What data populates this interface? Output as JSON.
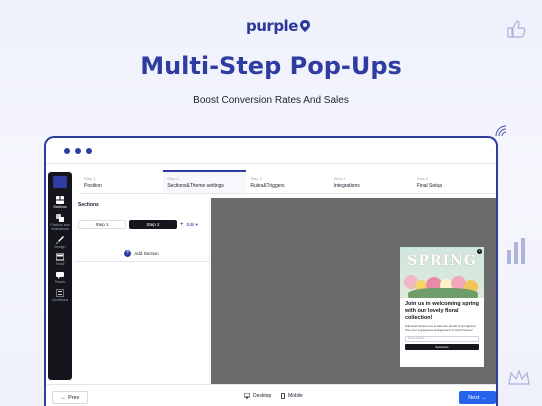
{
  "brand": {
    "logo_text": "purple"
  },
  "hero": {
    "title": "Multi-Step Pop-Ups",
    "subtitle": "Boost Conversion Rates And Sales"
  },
  "sidebar": {
    "items": [
      {
        "label": "Sections",
        "icon": "sections-icon"
      },
      {
        "label": "Position and Animations",
        "icon": "layers-icon"
      },
      {
        "label": "Design",
        "icon": "brush-icon"
      },
      {
        "label": "Email",
        "icon": "email-icon"
      },
      {
        "label": "Teaser",
        "icon": "teaser-icon"
      },
      {
        "label": "Conditions",
        "icon": "conditions-icon"
      }
    ]
  },
  "steps": [
    {
      "num": "Step 1",
      "name": "Position"
    },
    {
      "num": "Step 2",
      "name": "Sections&Theme settings"
    },
    {
      "num": "Step 3",
      "name": "Rules&Triggers"
    },
    {
      "num": "Step 4",
      "name": "Integrations"
    },
    {
      "num": "Step 5",
      "name": "Final Setup"
    }
  ],
  "panel": {
    "title": "Sections",
    "tab1": "Step 1",
    "tab2": "Step 2",
    "plus": "+",
    "edit": "Edit ▾",
    "add_section": "Add Section"
  },
  "popup": {
    "image_text": "SPRING",
    "heading": "Join us in welcoming spring with our lovely floral collection!",
    "body": "Add fresh flower now to take the arrival of springtime! Use it for a gorgeous arrangement of fresh flowers!",
    "input_placeholder": "Email address",
    "button": "Subscribe"
  },
  "footer": {
    "prev": "Prev",
    "desktop": "Desktop",
    "mobile": "Mobile",
    "next": "Next"
  },
  "colors": {
    "brand": "#2e3d9f",
    "sidebar_bg": "#15161c",
    "canvas_bg": "#6b6b6d",
    "next_button": "#2563eb"
  }
}
